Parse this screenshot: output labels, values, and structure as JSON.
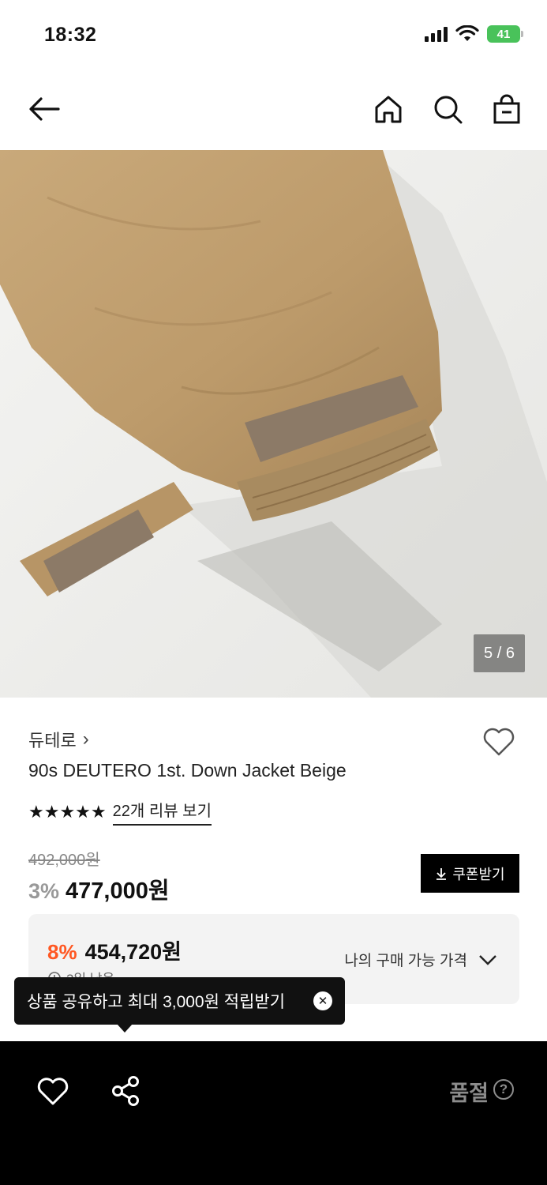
{
  "status_bar": {
    "time": "18:32",
    "battery": "41"
  },
  "nav": {
    "back_icon": "arrow-left-icon",
    "home_icon": "home-icon",
    "search_icon": "search-icon",
    "cart_icon": "shopping-bag-icon"
  },
  "gallery": {
    "indicator": "5 / 6",
    "current": 5,
    "total": 6
  },
  "product": {
    "brand": "듀테로",
    "brand_chevron": "›",
    "name": "90s DEUTERO 1st. Down Jacket Beige",
    "stars": "★★★★★",
    "rating": 5,
    "review_link": "22개 리뷰 보기"
  },
  "price": {
    "original": "492,000원",
    "discount_pct": "3%",
    "sale": "477,000원",
    "coupon_button": "쿠폰받기"
  },
  "best_price": {
    "discount_pct": "8%",
    "price": "454,720원",
    "sub_text": "3일 남음",
    "my_price_label": "나의 구매 가능 가격"
  },
  "tooltip": {
    "text": "상품 공유하고 최대 3,000원 적립받기",
    "close": "✕"
  },
  "bottom_bar": {
    "soldout_label": "품절",
    "help": "?"
  },
  "colors": {
    "accent_orange": "#ff5722",
    "battery_green": "#49c25a",
    "bottom_bar_bg": "#000000"
  }
}
